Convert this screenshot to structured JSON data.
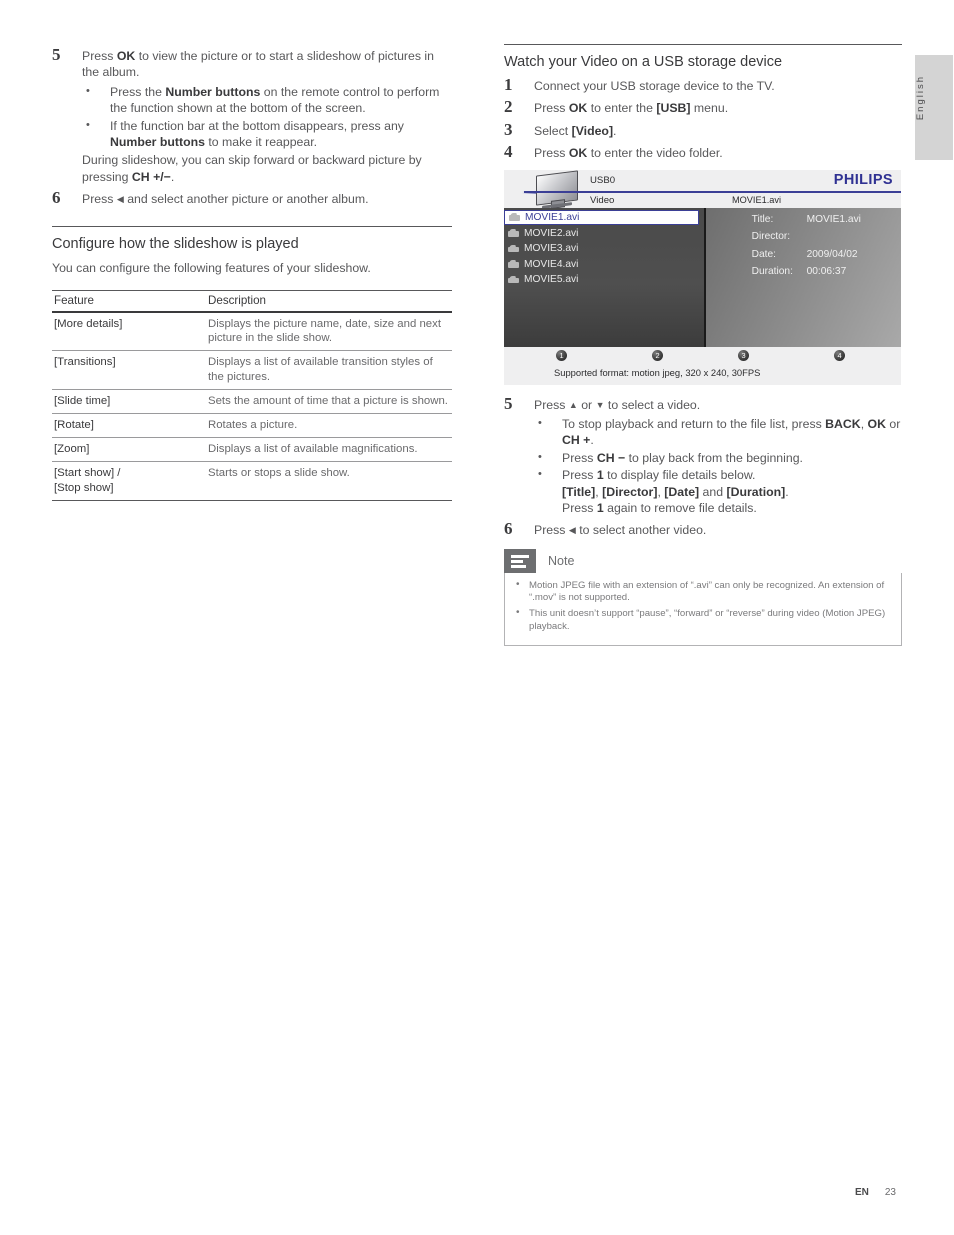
{
  "language_tab": "English",
  "left_column": {
    "step5": {
      "num": "5",
      "text_1": "Press ",
      "bold_1": "OK",
      "text_2": " to view the picture or to start a slideshow of pictures in the album.",
      "bullets": [
        {
          "t1": "Press the ",
          "b1": "Number buttons",
          "t2": " on the remote control to perform the function shown at the bottom of the screen."
        },
        {
          "t1": "If the function bar at the bottom disappears, press any ",
          "b1": "Number buttons",
          "t2": " to make it reappear."
        }
      ],
      "trailer_1": "During slideshow, you can skip forward or backward picture by pressing ",
      "trailer_bold": "CH +/−",
      "trailer_2": "."
    },
    "step6": {
      "num": "6",
      "text_1": "Press ",
      "arrow": "◀",
      "text_2": " and select another picture or another album."
    },
    "section_heading": "Configure how the slideshow is played",
    "section_intro": "You can configure the following features of your slideshow.",
    "table": {
      "headers": [
        "Feature",
        "Description"
      ],
      "rows": [
        [
          "[More details]",
          "Displays the picture name, date, size and next picture in the slide show."
        ],
        [
          "[Transitions]",
          "Displays a list of available transition styles of the pictures."
        ],
        [
          "[Slide time]",
          "Sets the amount of time that a picture is shown."
        ],
        [
          "[Rotate]",
          "Rotates a picture."
        ],
        [
          "[Zoom]",
          "Displays a list of available magnifications."
        ],
        [
          "[Start show] /\n[Stop show]",
          "Starts or stops a slide show."
        ]
      ]
    }
  },
  "right_column": {
    "section_heading": "Watch your Video on a USB storage device",
    "step1": {
      "num": "1",
      "text": "Connect your USB storage device to the TV."
    },
    "step2": {
      "num": "2",
      "t1": "Press ",
      "b1": "OK",
      "t2": " to enter the ",
      "b2": "[USB]",
      "t3": " menu."
    },
    "step3": {
      "num": "3",
      "t1": "Select ",
      "b1": "[Video]",
      "t2": "."
    },
    "step4": {
      "num": "4",
      "t1": "Press ",
      "b1": "OK",
      "t2": " to enter the video folder."
    },
    "tv_screen": {
      "brand": "PHILIPS",
      "device_label": "USB0",
      "folder_label": "Video",
      "current_file": "MOVIE1.avi",
      "files": [
        "MOVIE1.avi",
        "MOVIE2.avi",
        "MOVIE3.avi",
        "MOVIE4.avi",
        "MOVIE5.avi"
      ],
      "selected_index": 0,
      "details": [
        {
          "key": "Title:",
          "value": "MOVIE1.avi"
        },
        {
          "key": "Director:",
          "value": ""
        },
        {
          "key": "Date:",
          "value": "2009/04/02"
        },
        {
          "key": "Duration:",
          "value": "00:06:37"
        }
      ],
      "function_buttons": [
        "1",
        "2",
        "3",
        "4"
      ],
      "supported_format": "Supported format: motion jpeg, 320 x 240, 30FPS",
      "accent_color": "#3b3f96"
    },
    "step5": {
      "num": "5",
      "t1": "Press ",
      "up": "▲",
      "t2": " or ",
      "down": "▼",
      "t3": " to select a video.",
      "bullets": [
        {
          "t1": "To stop playback and return to the file list, press ",
          "b1": "BACK",
          "t2": ", ",
          "b2": "OK",
          "t3": " or ",
          "b3": "CH +",
          "t4": "."
        },
        {
          "t1": "Press ",
          "b1": "CH −",
          "t2": " to play back from the beginning."
        },
        {
          "t1": "Press ",
          "b1": "1",
          "t2": " to display file details below.",
          "line2_b1": "[Title]",
          "line2_t1": ", ",
          "line2_b2": "[Director]",
          "line2_t2": ", ",
          "line2_b3": "[Date]",
          "line2_t3": " and ",
          "line2_b4": "[Duration]",
          "line2_t4": ".",
          "line3_t1": "Press ",
          "line3_b1": "1",
          "line3_t2": " again to remove file details."
        }
      ]
    },
    "step6": {
      "num": "6",
      "t1": "Press ",
      "arrow": "◀",
      "t2": " to select another video."
    },
    "note": {
      "title": "Note",
      "items": [
        "Motion JPEG file with an extension of “.avi” can only be recognized. An extension of “.mov” is not supported.",
        "This unit doesn’t support “pause”, “forward” or “reverse” during video (Motion JPEG) playback."
      ]
    }
  },
  "footer": {
    "lang_code": "EN",
    "page_number": "23"
  }
}
